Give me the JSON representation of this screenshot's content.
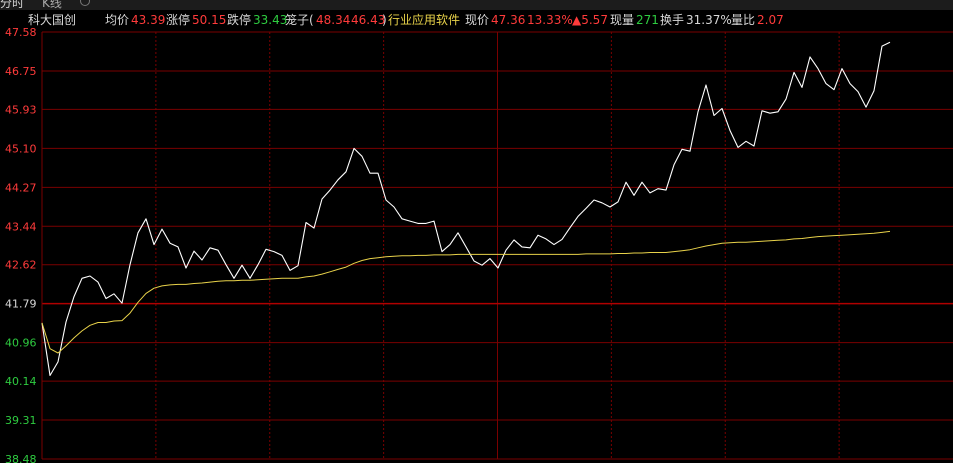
{
  "tabs": {
    "time": "分时",
    "kline": "K线",
    "refresh_icon": "refresh-icon"
  },
  "info": {
    "name": "科大国创",
    "avg_label": "均价",
    "avg_value": "43.39",
    "limit_up_label": "涨停",
    "limit_up_value": "50.15",
    "limit_down_label": "跌停",
    "limit_down_value": "33.43",
    "cage_label": "笼子(",
    "cage_low": "48.34",
    "cage_high": "46.43",
    "cage_close": ")",
    "industry": "行业应用软件",
    "price_label": "现价",
    "price_value": "47.36",
    "change_pct": "13.33%",
    "change_abs": "▲5.57",
    "volume_label": "现量",
    "volume_value": "271",
    "turnover_label": "换手",
    "turnover_value": "31.37%",
    "ratio_label": "量比",
    "ratio_value": "2.07"
  },
  "colors": {
    "up": "#ff3b3b",
    "down": "#2ecc40",
    "neutral": "#d8d8d8",
    "avg_line": "#e8d24a",
    "price_line": "#ffffff",
    "grid": "#7a0000",
    "industry": "#e8d24a"
  },
  "chart_data": {
    "type": "line",
    "prev_close": 41.79,
    "ylim": [
      38.48,
      47.58
    ],
    "y_ticks": [
      "47.58",
      "46.75",
      "45.93",
      "45.10",
      "44.27",
      "43.44",
      "42.62",
      "41.79",
      "40.96",
      "40.14",
      "39.31",
      "38.48"
    ],
    "series": [
      {
        "role": "price",
        "values": [
          41.38,
          40.26,
          40.55,
          41.4,
          41.94,
          42.33,
          42.38,
          42.25,
          41.9,
          42.0,
          41.8,
          42.62,
          43.3,
          43.6,
          43.05,
          43.38,
          43.08,
          43.0,
          42.55,
          42.91,
          42.72,
          42.98,
          42.93,
          42.62,
          42.33,
          42.61,
          42.33,
          42.62,
          42.95,
          42.9,
          42.82,
          42.5,
          42.6,
          43.52,
          43.4,
          44.02,
          44.21,
          44.43,
          44.6,
          45.1,
          44.93,
          44.57,
          44.57,
          44.0,
          43.85,
          43.6,
          43.55,
          43.5,
          43.5,
          43.55,
          42.9,
          43.05,
          43.3,
          43.0,
          42.7,
          42.61,
          42.75,
          42.55,
          42.93,
          43.15,
          43.0,
          42.98,
          43.25,
          43.17,
          43.05,
          43.16,
          43.41,
          43.65,
          43.82,
          44.0,
          43.94,
          43.85,
          43.96,
          44.38,
          44.1,
          44.38,
          44.15,
          44.24,
          44.21,
          44.75,
          45.08,
          45.04,
          45.88,
          46.45,
          45.8,
          45.95,
          45.48,
          45.12,
          45.25,
          45.15,
          45.9,
          45.85,
          45.88,
          46.15,
          46.72,
          46.4,
          47.05,
          46.8,
          46.48,
          46.35,
          46.8,
          46.48,
          46.31,
          45.98,
          46.33,
          47.28,
          47.36
        ]
      },
      {
        "role": "avg",
        "values": [
          41.38,
          40.83,
          40.74,
          40.89,
          41.06,
          41.21,
          41.33,
          41.39,
          41.39,
          41.42,
          41.43,
          41.59,
          41.82,
          42.01,
          42.12,
          42.17,
          42.19,
          42.2,
          42.2,
          42.22,
          42.23,
          42.25,
          42.27,
          42.28,
          42.28,
          42.29,
          42.29,
          42.3,
          42.31,
          42.32,
          42.33,
          42.33,
          42.33,
          42.36,
          42.38,
          42.42,
          42.47,
          42.52,
          42.57,
          42.65,
          42.71,
          42.75,
          42.77,
          42.79,
          42.8,
          42.81,
          42.81,
          42.82,
          42.82,
          42.83,
          42.83,
          42.83,
          42.84,
          42.84,
          42.84,
          42.84,
          42.84,
          42.84,
          42.84,
          42.84,
          42.84,
          42.84,
          42.84,
          42.84,
          42.84,
          42.84,
          42.84,
          42.84,
          42.85,
          42.85,
          42.85,
          42.85,
          42.86,
          42.86,
          42.87,
          42.87,
          42.88,
          42.88,
          42.88,
          42.9,
          42.92,
          42.94,
          42.98,
          43.02,
          43.05,
          43.08,
          43.09,
          43.1,
          43.1,
          43.11,
          43.12,
          43.13,
          43.14,
          43.15,
          43.17,
          43.18,
          43.2,
          43.22,
          43.23,
          43.24,
          43.25,
          43.26,
          43.27,
          43.28,
          43.29,
          43.31,
          43.33
        ]
      }
    ]
  }
}
